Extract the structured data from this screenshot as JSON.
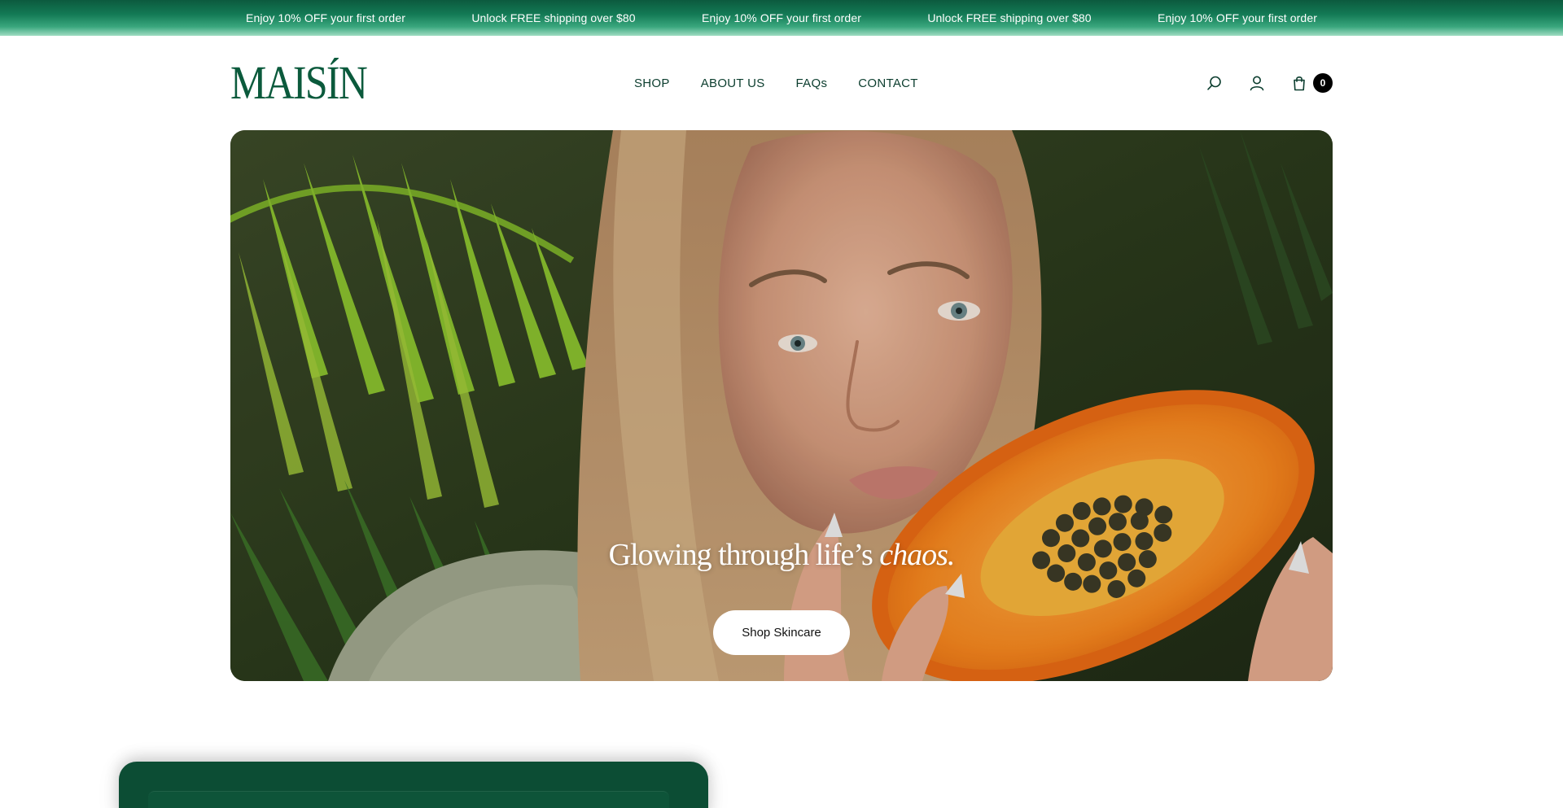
{
  "announcement": {
    "items": [
      "Enjoy 10% OFF your first order",
      "Unlock FREE shipping over $80",
      "Enjoy 10% OFF your first order",
      "Unlock FREE shipping over $80",
      "Enjoy 10% OFF your first order"
    ]
  },
  "header": {
    "logo": "MAISÍN",
    "nav": [
      "SHOP",
      "ABOUT US",
      "FAQs",
      "CONTACT"
    ],
    "icons": [
      "search-icon",
      "account-icon",
      "cart-icon"
    ],
    "cart_count": "0"
  },
  "hero": {
    "title_main": "Glowing through life’s ",
    "title_em": "chaos.",
    "cta": "Shop Skincare"
  },
  "colors": {
    "brand_green": "#0b5a3c",
    "announcement_bg": "#0c5a3e",
    "cta_bg": "#ffffff"
  }
}
